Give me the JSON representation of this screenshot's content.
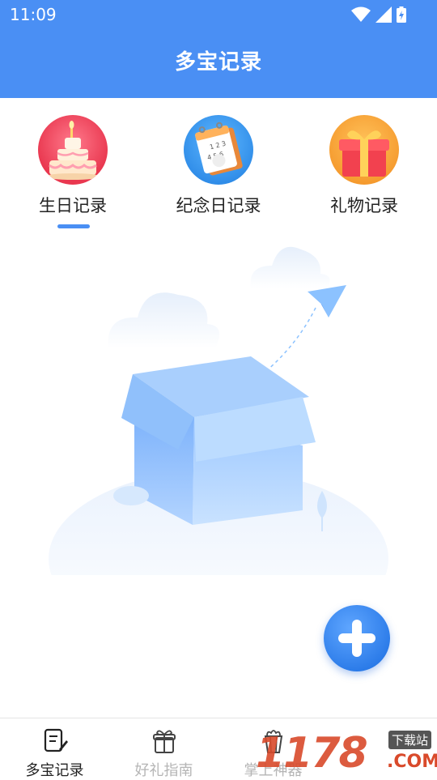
{
  "status_bar": {
    "time": "11:09"
  },
  "header": {
    "title": "多宝记录"
  },
  "categories": [
    {
      "label": "生日记录",
      "icon": "birthday-cake-icon",
      "selected": true
    },
    {
      "label": "纪念日记录",
      "icon": "calendar-icon",
      "selected": false
    },
    {
      "label": "礼物记录",
      "icon": "gift-box-icon",
      "selected": false
    }
  ],
  "bottom_nav": [
    {
      "label": "多宝记录",
      "icon": "notebook-pen-icon",
      "active": true
    },
    {
      "label": "好礼指南",
      "icon": "gift-icon",
      "active": false
    },
    {
      "label": "掌上神器",
      "icon": "popcorn-icon",
      "active": false
    }
  ],
  "watermark": {
    "text": "1178",
    "sub": "下载站",
    "domain": ".COM"
  },
  "colors": {
    "primary": "#4a8ff4",
    "fab": "#2a7ae8",
    "inactive_text": "#b5b5b5",
    "active_text": "#222222"
  }
}
